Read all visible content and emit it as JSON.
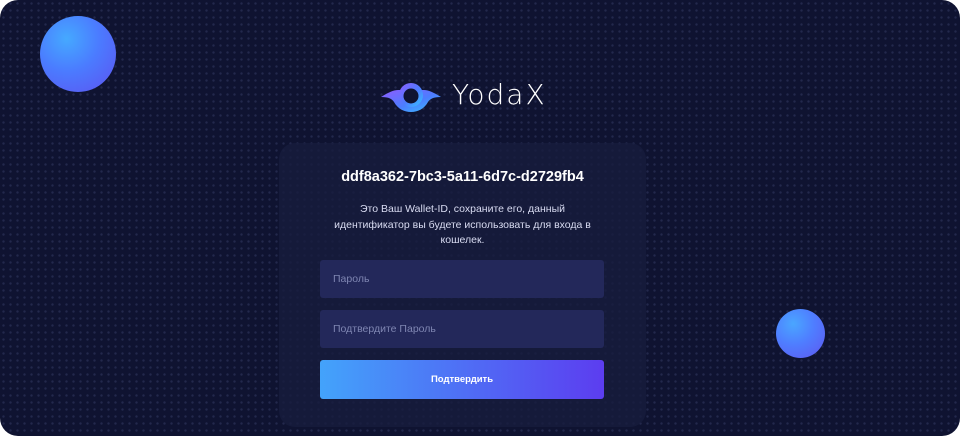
{
  "brand": {
    "name": "YodaX",
    "logo_icon": "yodax-logo-icon"
  },
  "wallet": {
    "id": "ddf8a362-7bc3-5a11-6d7c-d2729fb4",
    "description": "Это Ваш Wallet-ID, сохраните его, данный идентификатор вы будете использовать для входа в кошелек."
  },
  "form": {
    "password_placeholder": "Пароль",
    "confirm_placeholder": "Подтвердите Пароль",
    "submit_label": "Подтвердить"
  },
  "colors": {
    "background": "#0f1331",
    "card": "#171c3e",
    "input": "#23285a",
    "accent_start": "#43a3fb",
    "accent_end": "#5c3df0"
  }
}
